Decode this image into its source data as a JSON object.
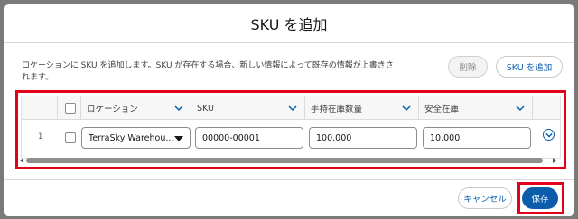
{
  "modal": {
    "title": "SKU を追加",
    "description": "ロケーションに SKU を追加します。SKU が存在する場合、新しい情報によって既存の情報が上書きされます。"
  },
  "toolbar": {
    "delete_label": "削除",
    "add_sku_label": "SKU を追加"
  },
  "table": {
    "headers": [
      "ロケーション",
      "SKU",
      "手持在庫数量",
      "安全在庫"
    ],
    "rows": [
      {
        "num": "1",
        "location": "TerraSky Warehou...",
        "sku": "00000-00001",
        "on_hand": "100.000",
        "safety_stock": "10.000"
      }
    ]
  },
  "footer": {
    "cancel_label": "キャンセル",
    "save_label": "保存"
  },
  "colors": {
    "accent": "#0b5cab",
    "highlight": "#e2001a"
  }
}
